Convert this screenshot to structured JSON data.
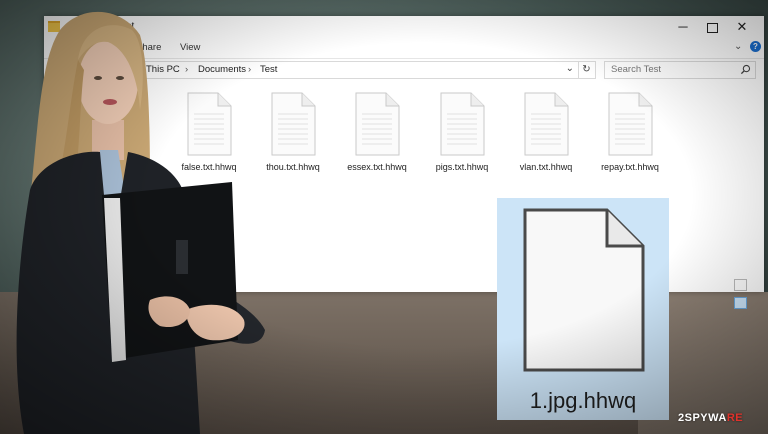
{
  "window": {
    "title": "Test",
    "ribbon_tabs": [
      "Share",
      "View"
    ],
    "controls": {
      "minimize": "─",
      "close": "✕"
    }
  },
  "address": {
    "crumbs": [
      "This PC",
      "Documents",
      "Test"
    ],
    "separator": "›"
  },
  "search": {
    "placeholder": "Search Test"
  },
  "files": [
    {
      "name": "false.txt.hhwq"
    },
    {
      "name": "thou.txt.hhwq"
    },
    {
      "name": "essex.txt.hhwq"
    },
    {
      "name": "pigs.txt.hhwq"
    },
    {
      "name": "vlan.txt.hhwq"
    },
    {
      "name": "repay.txt.hhwq"
    }
  ],
  "selected_file": {
    "name": "1.jpg.hhwq"
  },
  "watermark": {
    "part1": "2SPYWA",
    "part2": "RE"
  },
  "colors": {
    "selection": "#cce4f7",
    "folder": "#f3c84a",
    "help": "#1a6fd1",
    "watermark_accent": "#e0322b"
  },
  "icons": {
    "folder": "folder-icon",
    "search": "search-icon",
    "refresh": "refresh-icon",
    "help": "help-icon",
    "file": "document-icon"
  }
}
